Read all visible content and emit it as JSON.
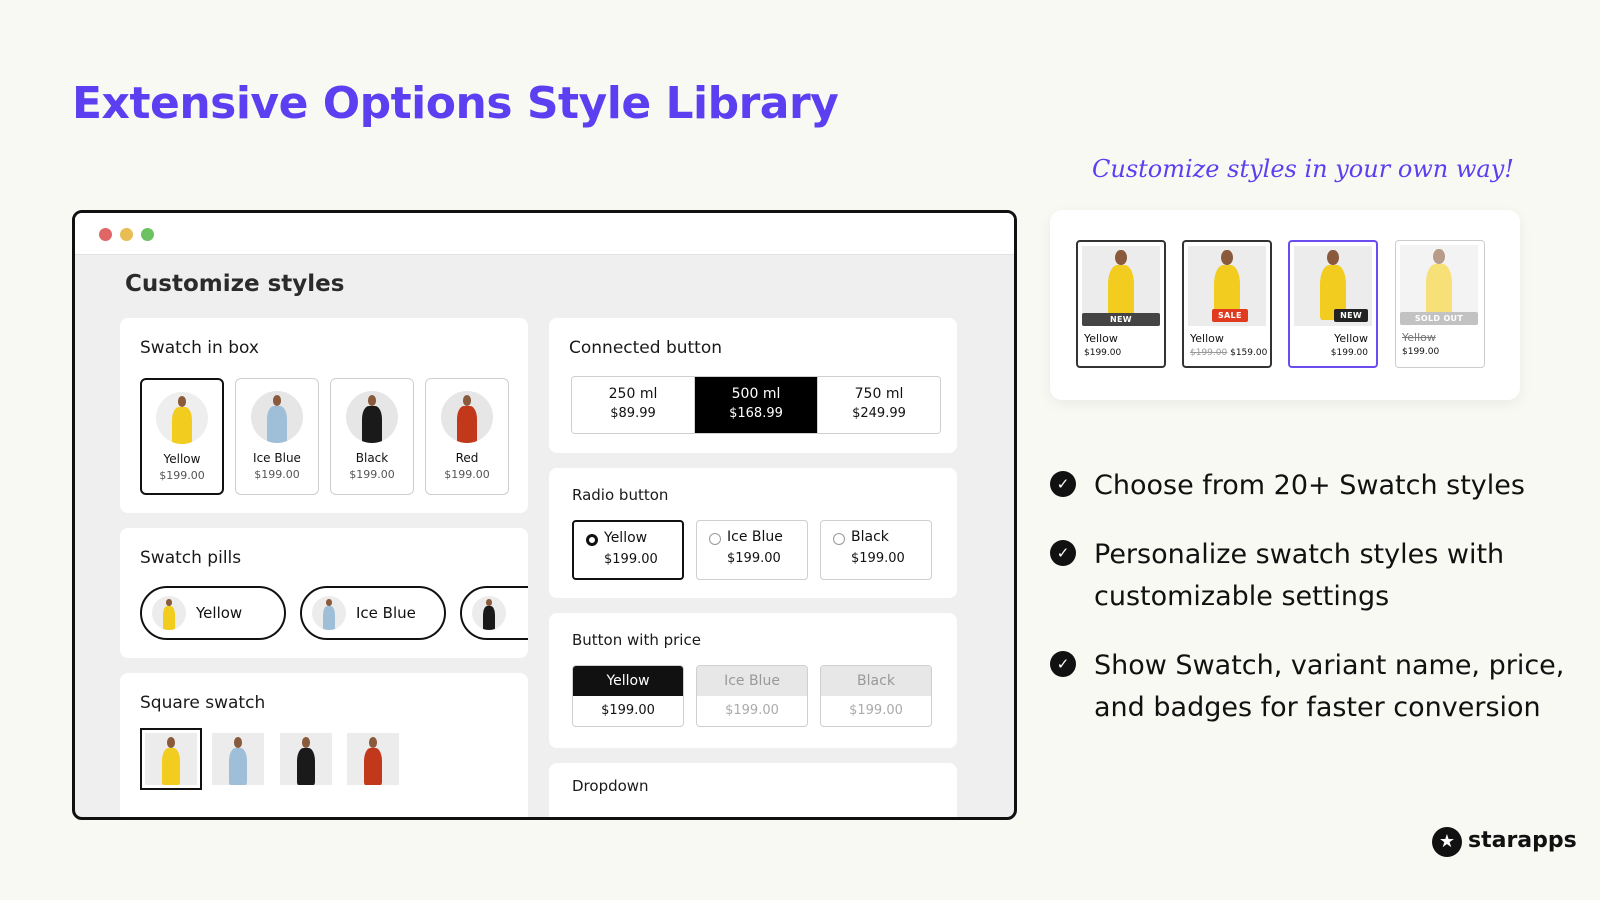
{
  "headline": "Extensive Options Style Library",
  "window": {
    "title": "Customize styles",
    "swatch_in_box": {
      "title": "Swatch in box",
      "items": [
        {
          "name": "Yellow",
          "price": "$199.00",
          "color": "#f2cc1f"
        },
        {
          "name": "Ice Blue",
          "price": "$199.00",
          "color": "#9fbfd9"
        },
        {
          "name": "Black",
          "price": "$199.00",
          "color": "#1a1a1a"
        },
        {
          "name": "Red",
          "price": "$199.00",
          "color": "#c2381a"
        }
      ]
    },
    "swatch_pills": {
      "title": "Swatch pills",
      "items": [
        {
          "name": "Yellow"
        },
        {
          "name": "Ice Blue"
        },
        {
          "name": ""
        }
      ]
    },
    "square_swatch": {
      "title": "Square swatch"
    },
    "connected_button": {
      "title": "Connected button",
      "items": [
        {
          "size": "250 ml",
          "price": "$89.99"
        },
        {
          "size": "500 ml",
          "price": "$168.99"
        },
        {
          "size": "750 ml",
          "price": "$249.99"
        }
      ]
    },
    "radio_button": {
      "title": "Radio button",
      "items": [
        {
          "name": "Yellow",
          "price": "$199.00"
        },
        {
          "name": "Ice Blue",
          "price": "$199.00"
        },
        {
          "name": "Black",
          "price": "$199.00"
        }
      ]
    },
    "button_with_price": {
      "title": "Button with price",
      "items": [
        {
          "name": "Yellow",
          "price": "$199.00"
        },
        {
          "name": "Ice Blue",
          "price": "$199.00"
        },
        {
          "name": "Black",
          "price": "$199.00"
        }
      ]
    },
    "dropdown": {
      "title": "Dropdown"
    }
  },
  "tagline": "Customize styles in your own way!",
  "badge_products": [
    {
      "name": "Yellow",
      "price": "$199.00",
      "badge": "NEW"
    },
    {
      "name": "Yellow",
      "old_price": "$199.00",
      "price": "$159.00",
      "badge": "SALE"
    },
    {
      "name": "Yellow",
      "price": "$199.00",
      "badge": "NEW"
    },
    {
      "name": "Yellow",
      "price": "$199.00",
      "badge": "SOLD OUT"
    }
  ],
  "features": [
    {
      "line1": "Choose from 20+ Swatch styles",
      "line2": ""
    },
    {
      "line1": "Personalize swatch styles with",
      "line2": "customizable settings"
    },
    {
      "line1": "Show Swatch, variant name, price,",
      "line2": "and badges for faster conversion"
    }
  ],
  "brand": "starapps",
  "colors": {
    "accent": "#5b3ff0",
    "yellow": "#f2cc1f",
    "ice_blue": "#9fbfd9",
    "black": "#1a1a1a",
    "red": "#c2381a",
    "sale": "#e03a1f",
    "new_badge": "#222222"
  }
}
